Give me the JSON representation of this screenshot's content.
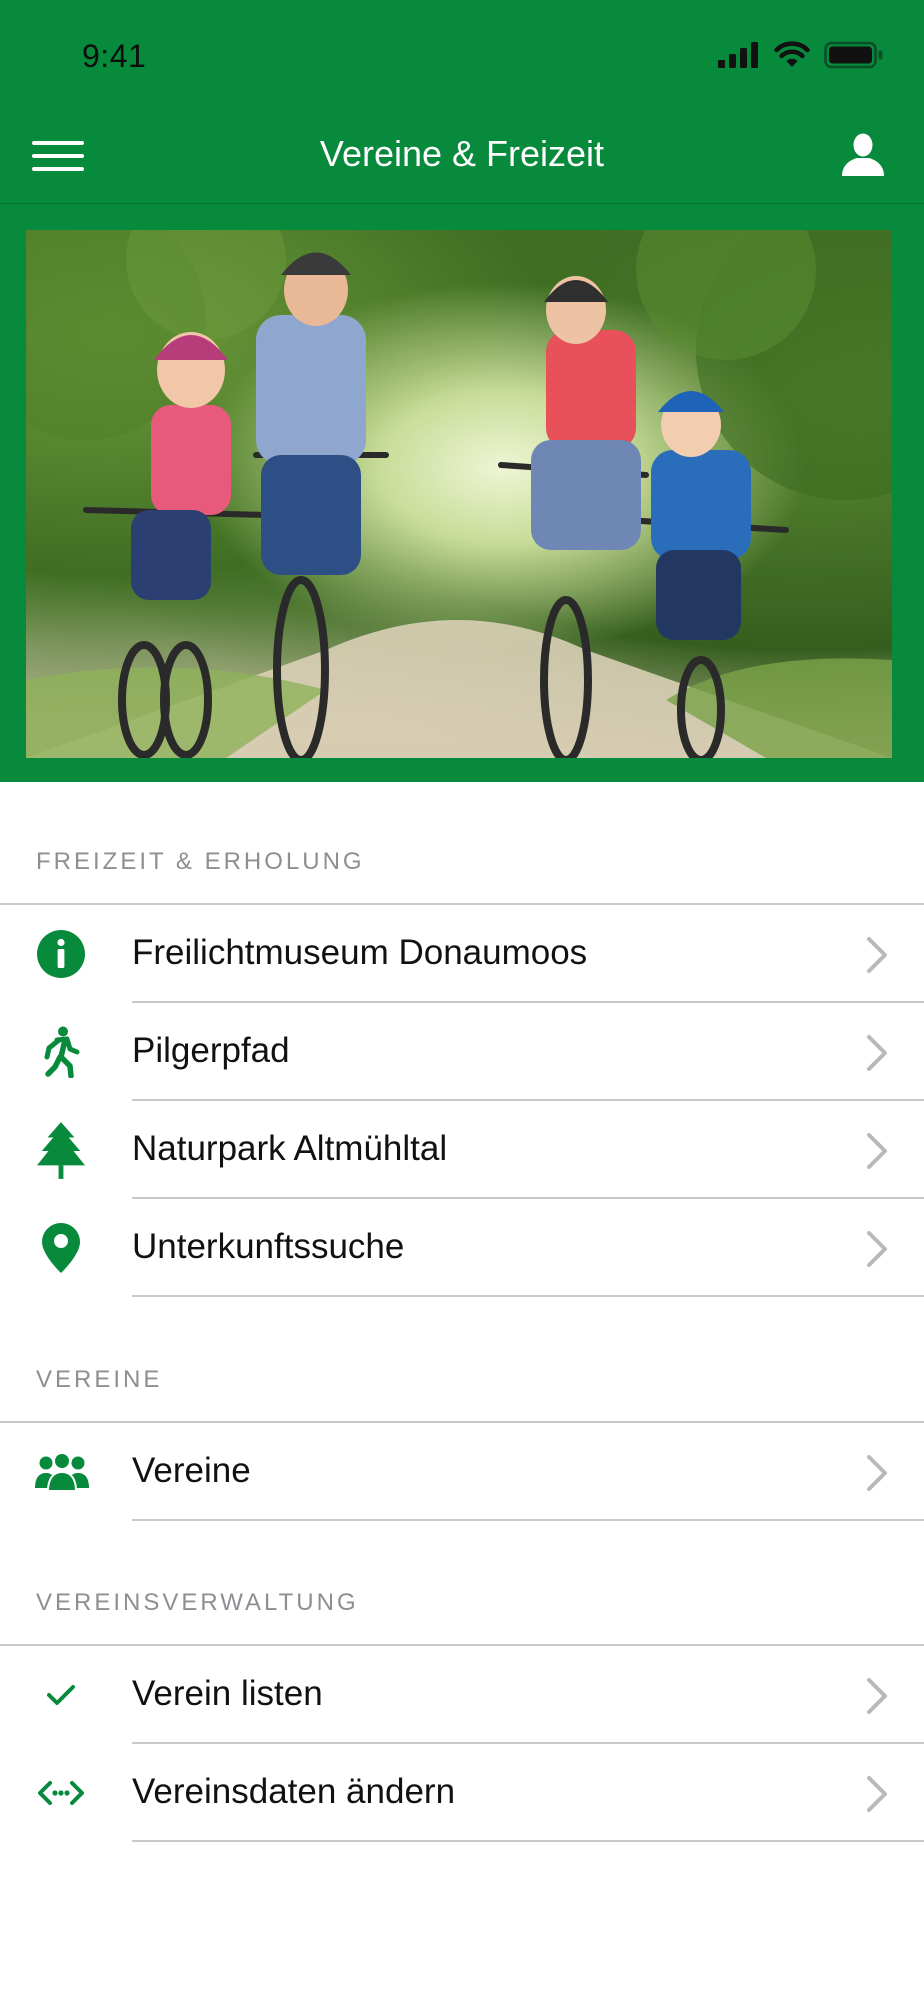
{
  "status_bar": {
    "time": "9:41"
  },
  "navbar": {
    "title": "Vereine & Freizeit",
    "menu_icon": "hamburger-icon",
    "profile_icon": "user-icon"
  },
  "hero": {
    "description": "family-cycling-photo"
  },
  "colors": {
    "brand_green": "#078a3c",
    "section_text": "#8e8e93",
    "chevron": "#b8b8bd"
  },
  "sections": [
    {
      "title": "FREIZEIT & ERHOLUNG",
      "items": [
        {
          "label": "Freilichtmuseum Donaumoos",
          "icon": "info-icon"
        },
        {
          "label": "Pilgerpfad",
          "icon": "walking-icon"
        },
        {
          "label": "Naturpark Altmühltal",
          "icon": "tree-icon"
        },
        {
          "label": "Unterkunftssuche",
          "icon": "map-pin-icon"
        }
      ]
    },
    {
      "title": "VEREINE",
      "items": [
        {
          "label": "Vereine",
          "icon": "group-icon"
        }
      ]
    },
    {
      "title": "VEREINSVERWALTUNG",
      "items": [
        {
          "label": "Verein listen",
          "icon": "checkmark-icon"
        },
        {
          "label": "Vereinsdaten ändern",
          "icon": "code-arrows-icon"
        }
      ]
    }
  ]
}
